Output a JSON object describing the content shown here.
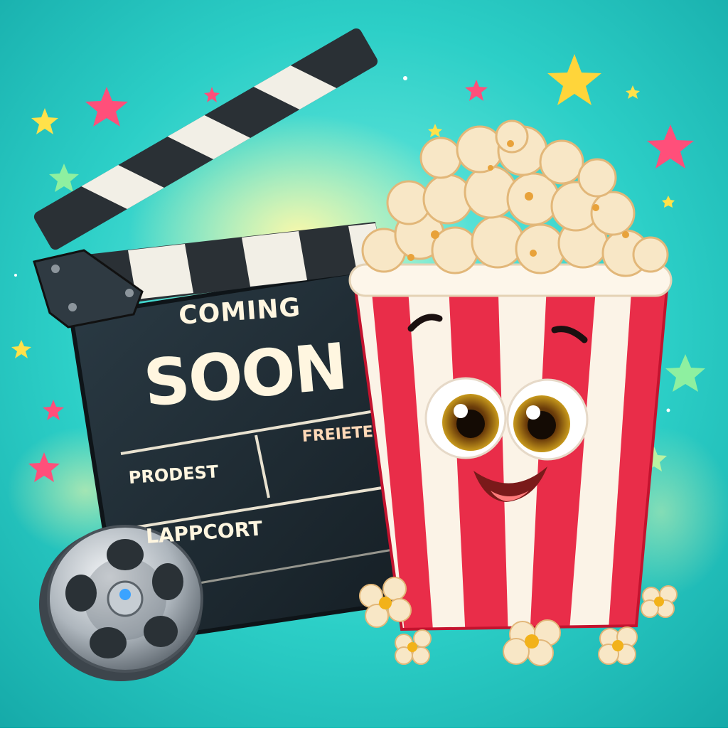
{
  "slate": {
    "line1": "COMING",
    "line2": "SOON",
    "field_left": "PRODEST",
    "field_right": "FREIETE",
    "field_bottom": "LAPPCORT"
  },
  "colors": {
    "background": "#2ad0c8",
    "slate": "#1f2d36",
    "cup_red": "#e8203e",
    "cup_white": "#fbf3e6",
    "popcorn": "#f8e7c6",
    "star_pink": "#ff4f7a",
    "star_yellow": "#ffe14a",
    "star_green": "#8ef0a0"
  }
}
